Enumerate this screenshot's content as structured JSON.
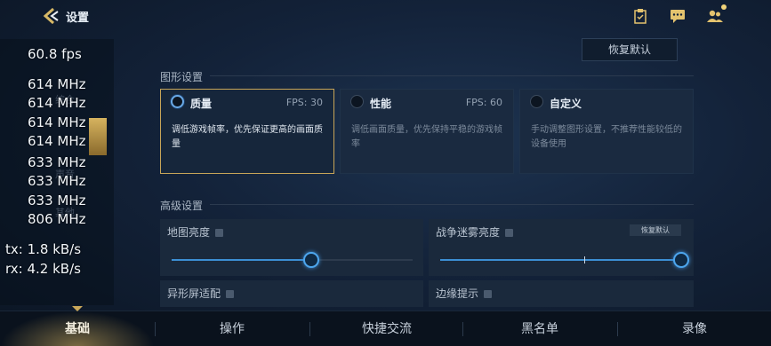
{
  "header": {
    "title": "设置"
  },
  "overlay": {
    "fps": "60.8 fps",
    "freqs": [
      "614 MHz",
      "614 MHz",
      "614 MHz",
      "614 MHz",
      "633 MHz",
      "633 MHz",
      "633 MHz",
      "806 MHz"
    ],
    "tx": "tx: 1.8 kB/s",
    "rx": "rx: 4.2 kB/s"
  },
  "restore_label": "恢复默认",
  "graphics": {
    "title": "图形设置",
    "options": [
      {
        "name": "质量",
        "fps": "FPS: 30",
        "desc": "调低游戏帧率，优先保证更高的画面质量",
        "selected": true
      },
      {
        "name": "性能",
        "fps": "FPS: 60",
        "desc": "调低画面质量，优先保持平稳的游戏帧率",
        "selected": false
      },
      {
        "name": "自定义",
        "fps": "",
        "desc": "手动调整图形设置，不推荐性能较低的设备使用",
        "selected": false
      }
    ]
  },
  "advanced": {
    "title": "高级设置",
    "map_brightness": {
      "label": "地图亮度",
      "value_pct": 58
    },
    "fog_brightness": {
      "label": "战争迷雾亮度",
      "reset": "恢复默认",
      "value_pct": 100
    },
    "screen_adapt": {
      "label": "异形屏适配"
    },
    "edge_hint": {
      "label": "边缘提示"
    }
  },
  "tabs": [
    "基础",
    "操作",
    "快捷交流",
    "黑名单",
    "录像"
  ],
  "colors": {
    "accent_gold": "#c8a558",
    "slider_blue": "#3c8fd4"
  }
}
